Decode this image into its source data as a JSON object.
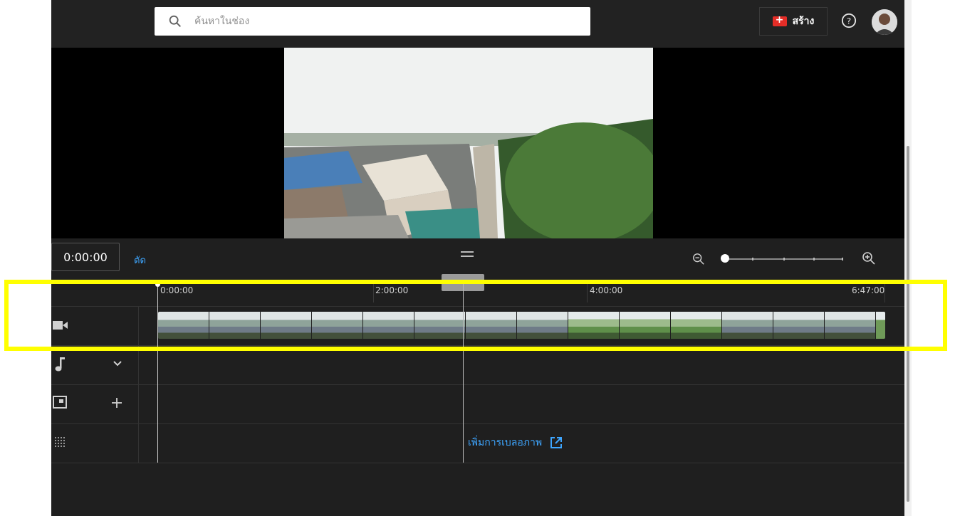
{
  "search": {
    "placeholder": "ค้นหาในช่อง"
  },
  "header": {
    "create_label": "สร้าง",
    "help_icon": "help-circle-icon",
    "create_icon": "video-add-icon"
  },
  "editor": {
    "timecode": "0:00:00",
    "trim_label": "ตัด",
    "playhead_position": "2:50:10"
  },
  "timeline": {
    "ticks": [
      "0:00:00",
      "2:00:00",
      "4:00:00",
      "6:47:00"
    ],
    "blur_link_label": "เพิ่มการเบลอภาพ",
    "tracks": [
      {
        "name": "video",
        "icon": "video-camera-icon"
      },
      {
        "name": "audio",
        "icon": "music-note-icon"
      },
      {
        "name": "end-screen",
        "icon": "end-screen-icon"
      },
      {
        "name": "blur",
        "icon": "blur-grid-icon"
      }
    ]
  },
  "colors": {
    "accent_link": "#3ea6ff",
    "create_red": "#e52d27",
    "highlight": "#ffff00",
    "background": "#1f1f1f"
  }
}
